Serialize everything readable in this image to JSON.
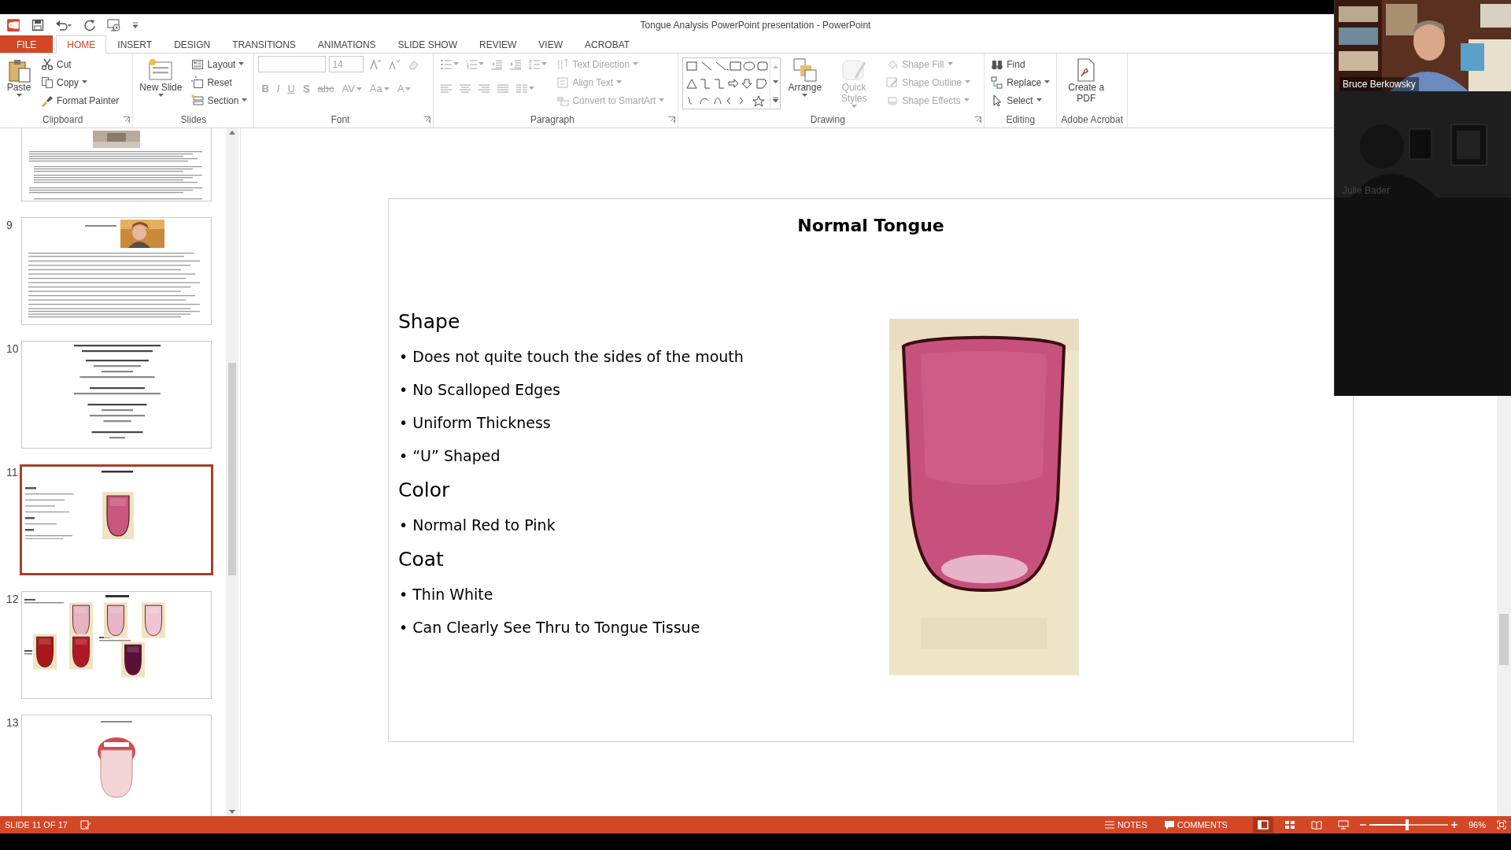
{
  "window": {
    "title": "Tongue Analysis PowerPoint presentation - PowerPoint"
  },
  "tabs": [
    {
      "label": "FILE",
      "kind": "file",
      "selected": false
    },
    {
      "label": "HOME",
      "kind": "tab",
      "selected": true
    },
    {
      "label": "INSERT",
      "kind": "tab",
      "selected": false
    },
    {
      "label": "DESIGN",
      "kind": "tab",
      "selected": false
    },
    {
      "label": "TRANSITIONS",
      "kind": "tab",
      "selected": false
    },
    {
      "label": "ANIMATIONS",
      "kind": "tab",
      "selected": false
    },
    {
      "label": "SLIDE SHOW",
      "kind": "tab",
      "selected": false
    },
    {
      "label": "REVIEW",
      "kind": "tab",
      "selected": false
    },
    {
      "label": "VIEW",
      "kind": "tab",
      "selected": false
    },
    {
      "label": "ACROBAT",
      "kind": "tab",
      "selected": false
    }
  ],
  "ribbon": {
    "groups": [
      {
        "label": "Clipboard",
        "launcher": true,
        "columns": [
          [
            [
              {
                "kind": "large",
                "label": "Paste",
                "dropdown": true,
                "disabled": false
              }
            ]
          ],
          [
            [
              {
                "kind": "small",
                "label": "Cut",
                "disabled": false
              }
            ],
            [
              {
                "kind": "small",
                "label": "Copy",
                "dropdown": true,
                "disabled": false
              }
            ],
            [
              {
                "kind": "small",
                "label": "Format Painter",
                "disabled": false
              }
            ]
          ]
        ]
      },
      {
        "label": "Slides",
        "launcher": false,
        "columns": [
          [
            [
              {
                "kind": "large",
                "label": "New Slide",
                "dropdown": true,
                "disabled": false
              }
            ]
          ],
          [
            [
              {
                "kind": "small",
                "label": "Layout",
                "dropdown": true,
                "disabled": false
              }
            ],
            [
              {
                "kind": "small",
                "label": "Reset",
                "disabled": false
              }
            ],
            [
              {
                "kind": "small",
                "label": "Section",
                "dropdown": true,
                "disabled": false
              }
            ]
          ]
        ]
      },
      {
        "label": "Font",
        "launcher": true,
        "columns": [
          [
            [
              {
                "kind": "field",
                "disabled": true
              },
              {
                "kind": "field",
                "value": "14",
                "disabled": true
              },
              {
                "kind": "icon",
                "disabled": true
              },
              {
                "kind": "icon",
                "disabled": true
              },
              {
                "kind": "icon",
                "disabled": true
              }
            ],
            [
              {
                "kind": "glyph",
                "label": "B",
                "disabled": true
              },
              {
                "kind": "glyph",
                "label": "I",
                "disabled": true
              },
              {
                "kind": "glyph",
                "label": "U",
                "disabled": true
              },
              {
                "kind": "glyph",
                "label": "S",
                "disabled": true
              },
              {
                "kind": "glyph",
                "label": "abc",
                "disabled": true
              },
              {
                "kind": "glyph",
                "label": "AV",
                "dropdown": true,
                "disabled": true
              },
              {
                "kind": "glyph",
                "label": "Aa",
                "dropdown": true,
                "disabled": true
              },
              {
                "kind": "glyph",
                "label": "A",
                "dropdown": true,
                "disabled": true
              }
            ]
          ]
        ]
      },
      {
        "label": "Paragraph",
        "launcher": true,
        "columns": [
          [
            [
              {
                "kind": "icon",
                "dropdown": true,
                "disabled": true
              },
              {
                "kind": "icon",
                "dropdown": true,
                "disabled": true
              },
              {
                "kind": "icon",
                "disabled": true
              },
              {
                "kind": "icon",
                "disabled": true
              },
              {
                "kind": "icon",
                "dropdown": true,
                "disabled": true
              }
            ],
            [
              {
                "kind": "icon",
                "disabled": true
              },
              {
                "kind": "icon",
                "disabled": true
              },
              {
                "kind": "icon",
                "disabled": true
              },
              {
                "kind": "icon",
                "disabled": true
              },
              {
                "kind": "icon",
                "dropdown": true,
                "disabled": true
              }
            ]
          ],
          [
            [
              {
                "kind": "small",
                "label": "Text Direction",
                "dropdown": true,
                "disabled": true
              }
            ],
            [
              {
                "kind": "small",
                "label": "Align Text",
                "dropdown": true,
                "disabled": true
              }
            ],
            [
              {
                "kind": "small",
                "label": "Convert to SmartArt",
                "dropdown": true,
                "disabled": true
              }
            ]
          ]
        ]
      },
      {
        "label": "Drawing",
        "launcher": true,
        "columns": [
          [
            [
              {
                "kind": "gallery",
                "disabled": false
              }
            ]
          ],
          [
            [
              {
                "kind": "large",
                "label": "Arrange",
                "dropdown": true,
                "disabled": false
              }
            ]
          ],
          [
            [
              {
                "kind": "large",
                "label": "Quick Styles",
                "dropdown": true,
                "disabled": true
              }
            ]
          ],
          [
            [
              {
                "kind": "small",
                "label": "Shape Fill",
                "dropdown": true,
                "disabled": true
              }
            ],
            [
              {
                "kind": "small",
                "label": "Shape Outline",
                "dropdown": true,
                "disabled": true
              }
            ],
            [
              {
                "kind": "small",
                "label": "Shape Effects",
                "dropdown": true,
                "disabled": true
              }
            ]
          ]
        ]
      },
      {
        "label": "Editing",
        "launcher": false,
        "columns": [
          [
            [
              {
                "kind": "small",
                "label": "Find",
                "disabled": false
              }
            ],
            [
              {
                "kind": "small",
                "label": "Replace",
                "dropdown": true,
                "disabled": false
              }
            ],
            [
              {
                "kind": "small",
                "label": "Select",
                "dropdown": true,
                "disabled": false
              }
            ]
          ]
        ]
      },
      {
        "label": "Adobe Acrobat",
        "launcher": false,
        "columns": [
          [
            [
              {
                "kind": "large",
                "label": "Create a PDF",
                "disabled": false
              }
            ]
          ]
        ]
      }
    ]
  },
  "thumbnails": [
    {
      "kind": "article",
      "selected": false
    },
    {
      "number": "9",
      "kind": "picture-right",
      "selected": false
    },
    {
      "number": "10",
      "kind": "outline",
      "selected": false
    },
    {
      "number": "11",
      "kind": "bullets-picture",
      "selected": true
    },
    {
      "number": "12",
      "kind": "gallery",
      "selected": false
    },
    {
      "number": "13",
      "kind": "diagram",
      "selected": false
    }
  ],
  "slide": {
    "title": "Normal Tongue",
    "sections": [
      {
        "heading": "Shape",
        "bullets": [
          "• Does not quite touch the sides of the mouth",
          "• No Scalloped Edges",
          "• Uniform Thickness",
          "• “U” Shaped"
        ]
      },
      {
        "heading": "Color",
        "bullets": [
          "• Normal Red to Pink"
        ]
      },
      {
        "heading": "Coat",
        "bullets": [
          "• Thin White",
          "• Can Clearly See Thru to Tongue Tissue"
        ]
      }
    ]
  },
  "status_bar": {
    "slide_indicator": "SLIDE 11 OF 17",
    "notes": "NOTES",
    "comments": "COMMENTS",
    "views": [
      {
        "selected": true
      },
      {
        "selected": false
      },
      {
        "selected": false
      },
      {
        "selected": false
      }
    ],
    "zoom": {
      "level": 0.48,
      "reading": "96%"
    }
  },
  "video_call": {
    "participants": [
      {
        "name": "Bruce Berkowsky",
        "dimmed": false
      },
      {
        "name": "Julie Bader",
        "dimmed": true
      }
    ]
  }
}
